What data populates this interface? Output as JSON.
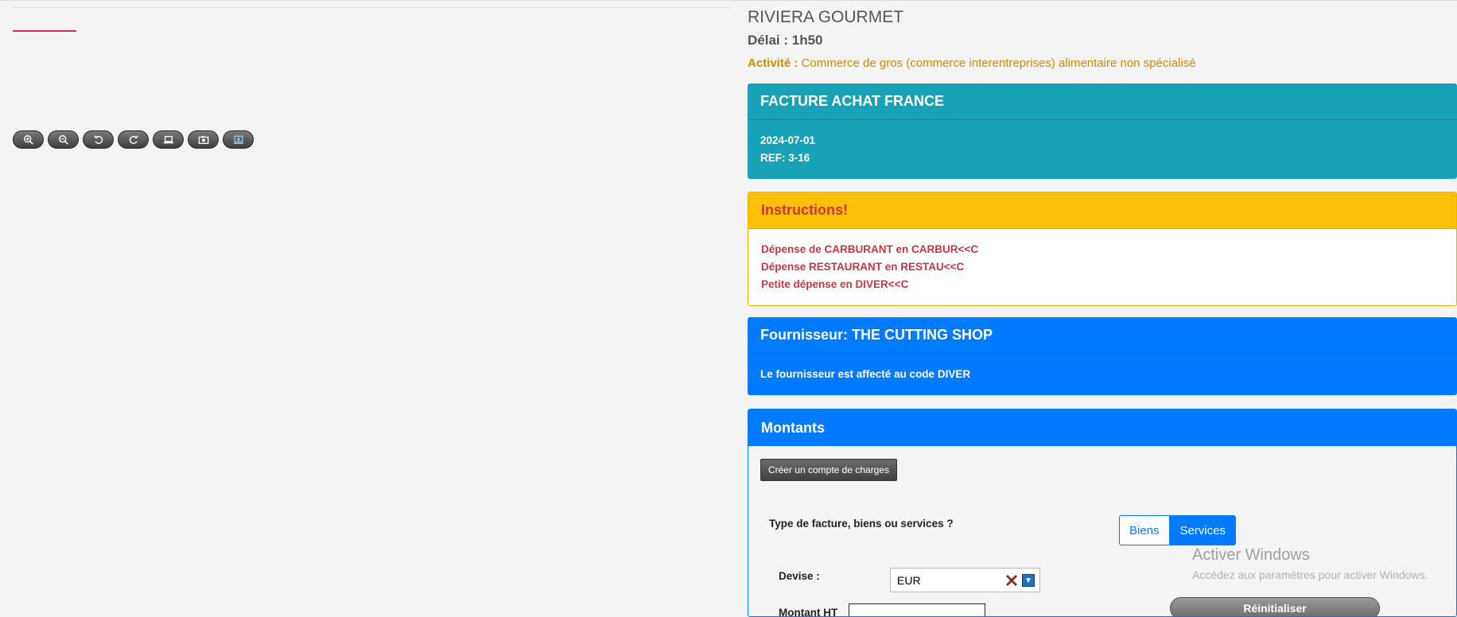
{
  "company": "RIVIERA GOURMET",
  "delai": "Délai : 1h50",
  "activite": {
    "label": "Activité :",
    "value": "Commerce de gros (commerce interentreprises) alimentaire non spécialisé"
  },
  "toolbar": [
    "zoom-in-icon",
    "zoom-out-icon",
    "rotate-left-icon",
    "rotate-right-icon",
    "fit-screen-icon",
    "photo-icon",
    "download-screen-icon"
  ],
  "facture": {
    "title": "FACTURE ACHAT FRANCE",
    "date": "2024-07-01",
    "ref": "REF: 3-16"
  },
  "instructions": {
    "title": "Instructions!",
    "lines": [
      "Dépense de CARBURANT en CARBUR<<C",
      "Dépense RESTAURANT en RESTAU<<C",
      "Petite dépense en DIVER<<C"
    ]
  },
  "fournisseur": {
    "title": "Fournisseur: THE CUTTING SHOP",
    "body": "Le fournisseur est affecté au code DIVER"
  },
  "montants": {
    "title": "Montants",
    "create_button": "Créer un compte de charges",
    "type_label": "Type de facture, biens ou services ?",
    "option_biens": "Biens",
    "option_services": "Services",
    "devise_label": "Devise :",
    "devise_value": "EUR",
    "montant_ht_label": "Montant HT",
    "reset_button": "Réinitialiser"
  },
  "watermark": {
    "title": "Activer Windows",
    "subtitle": "Accédez aux paramètres pour activer Windows."
  },
  "colors": {
    "info": "#17a2b8",
    "warning": "#ffc107",
    "primary": "#007bff",
    "danger_text": "#cc3644",
    "activity": "#d48a00"
  }
}
